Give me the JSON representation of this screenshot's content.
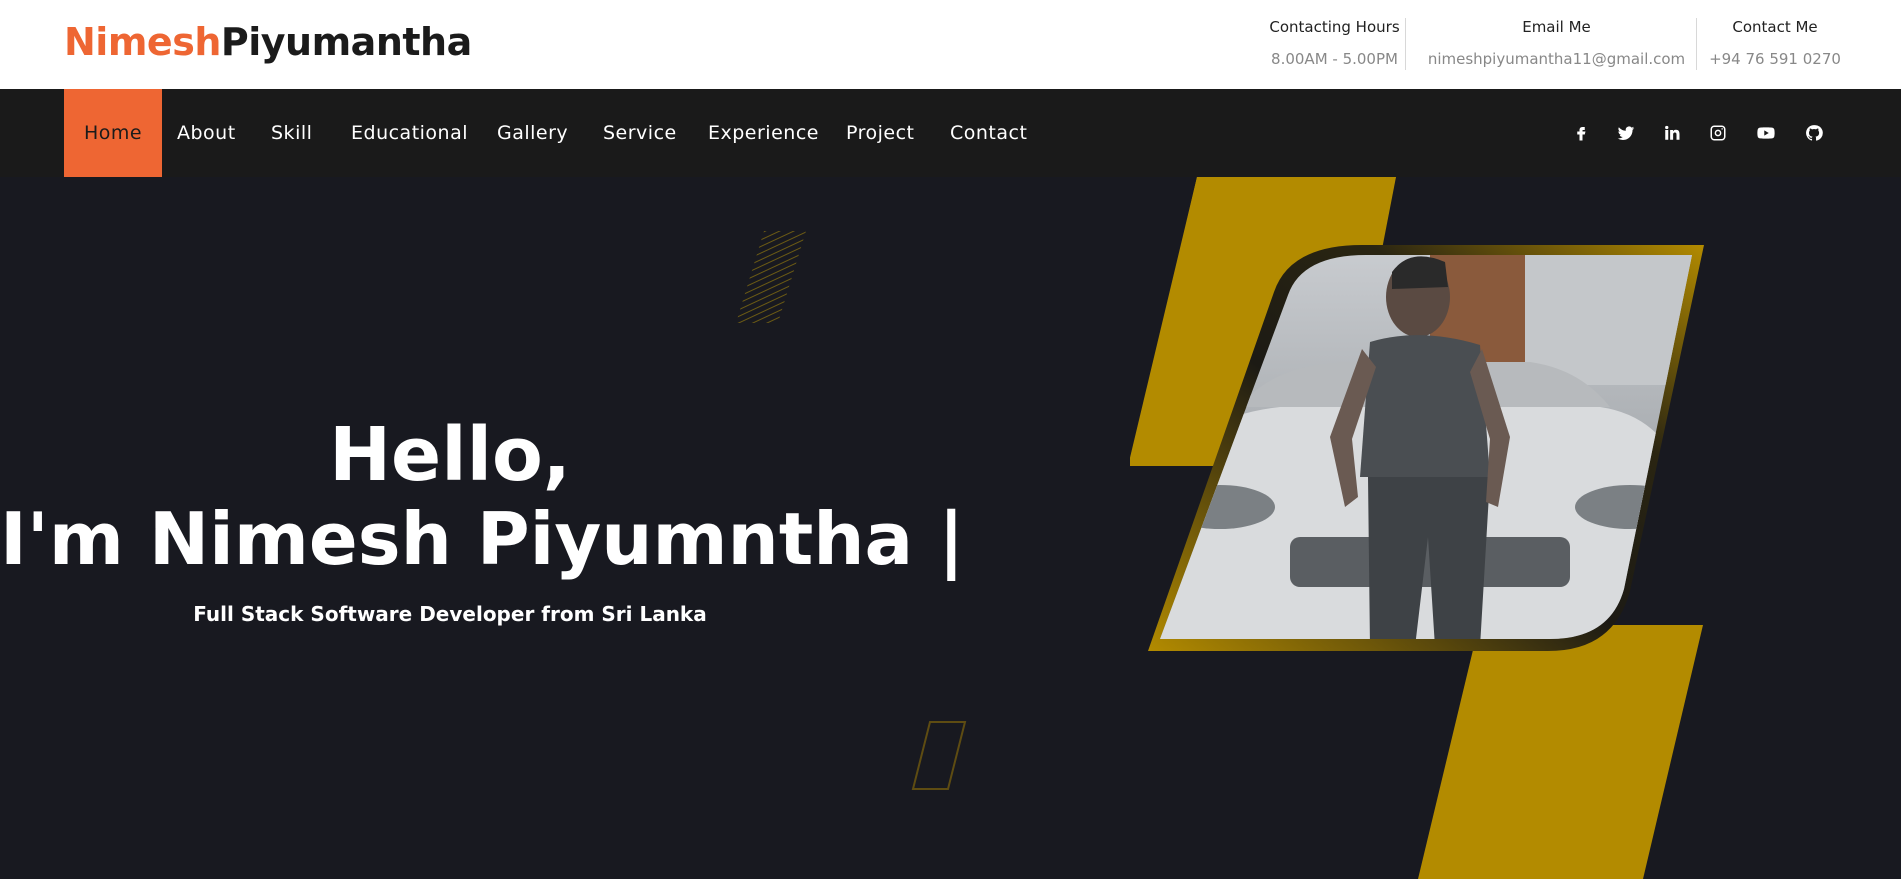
{
  "logo": {
    "first": "Nimesh",
    "last": "Piyumantha"
  },
  "contact": [
    {
      "title": "Contacting Hours",
      "value": "8.00AM - 5.00PM"
    },
    {
      "title": "Email Me",
      "value": "nimeshpiyumantha11@gmail.com"
    },
    {
      "title": "Contact Me",
      "value": "+94 76 591 0270"
    }
  ],
  "nav": {
    "items": [
      "Home",
      "About",
      "Skill",
      "Educational",
      "Gallery",
      "Service",
      "Experience",
      "Project",
      "Contact"
    ],
    "active": "Home"
  },
  "social": [
    "facebook-icon",
    "twitter-icon",
    "linkedin-icon",
    "instagram-icon",
    "youtube-icon",
    "github-icon"
  ],
  "hero": {
    "greeting": "Hello,",
    "name": "I'm Nimesh Piyumntha |",
    "subtitle": "Full Stack Software Developer from Sri Lanka"
  },
  "colors": {
    "accent": "#ee6633",
    "gold": "#b38b00",
    "dark": "#181920",
    "nav": "#1a1a1a"
  }
}
